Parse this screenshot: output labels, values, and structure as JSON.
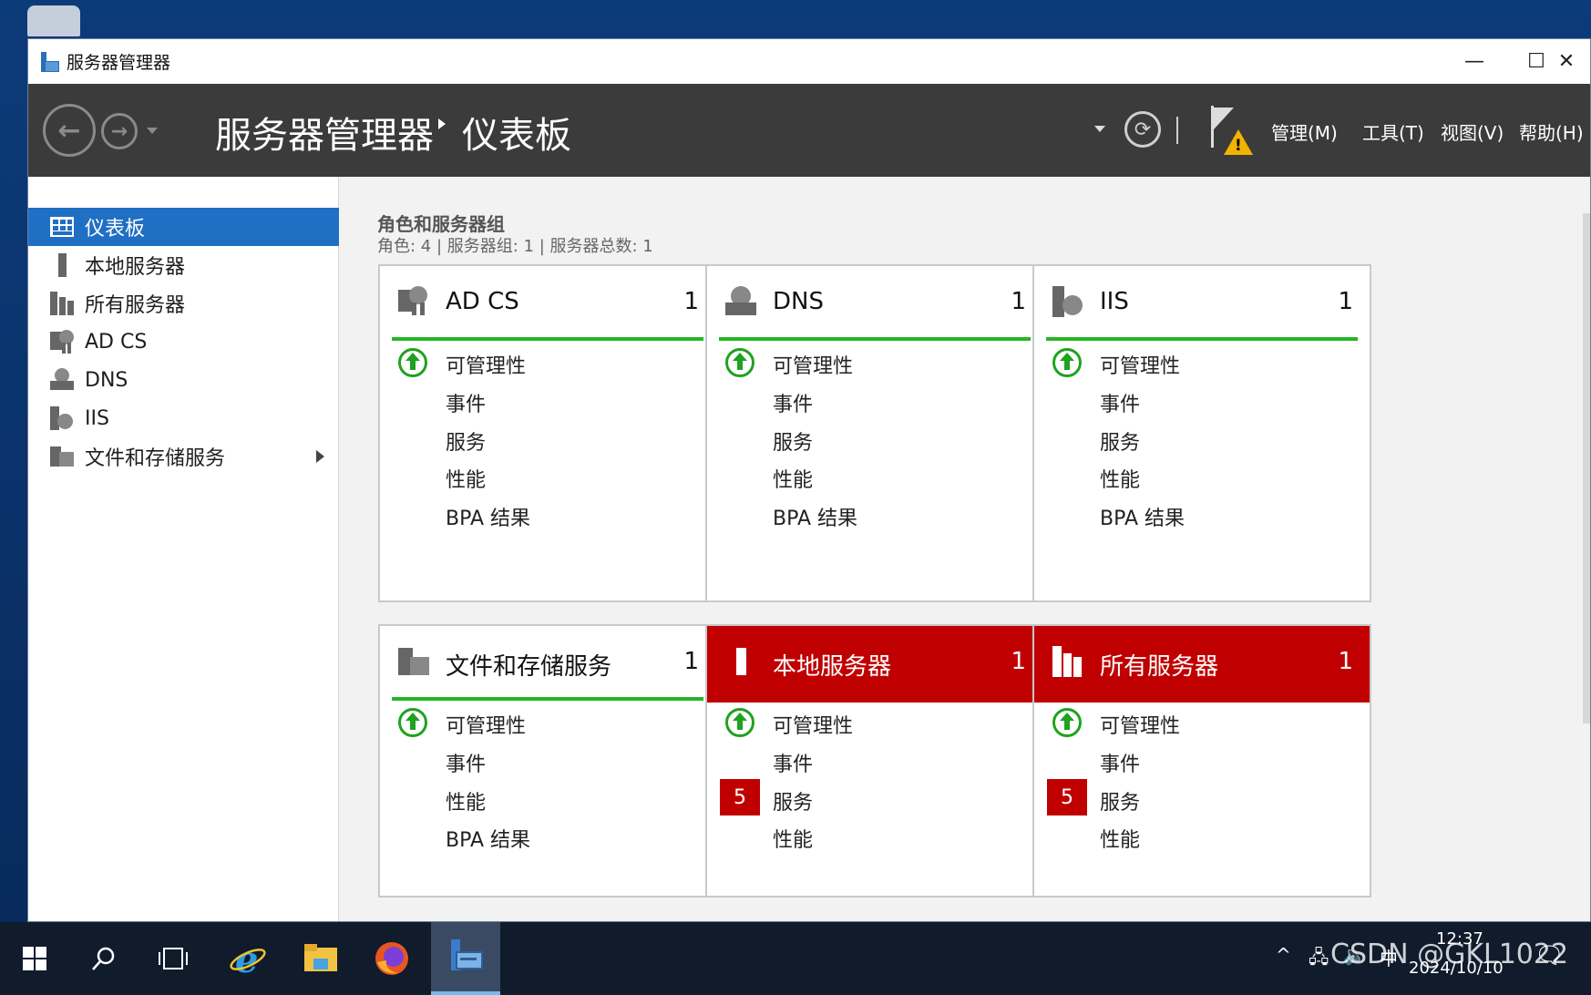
{
  "window": {
    "title": "服务器管理器",
    "controls": {
      "minimize": "—",
      "maximize": "☐",
      "close": "✕"
    }
  },
  "header": {
    "breadcrumb_root": "服务器管理器",
    "breadcrumb_page": "仪表板",
    "menus": [
      "管理(M)",
      "工具(T)",
      "视图(V)",
      "帮助(H)"
    ],
    "refresh_glyph": "⟳"
  },
  "sidebar": {
    "items": [
      {
        "label": "仪表板",
        "icon": "dashboard-icon",
        "active": true
      },
      {
        "label": "本地服务器",
        "icon": "local-server-icon"
      },
      {
        "label": "所有服务器",
        "icon": "all-servers-icon"
      },
      {
        "label": "AD CS",
        "icon": "adcs-icon"
      },
      {
        "label": "DNS",
        "icon": "dns-icon"
      },
      {
        "label": "IIS",
        "icon": "iis-icon"
      },
      {
        "label": "文件和存储服务",
        "icon": "file-storage-icon",
        "expandable": true
      }
    ]
  },
  "main": {
    "section_title": "角色和服务器组",
    "section_subtitle": "角色: 4 | 服务器组: 1 | 服务器总数: 1",
    "tiles": [
      {
        "name": "AD CS",
        "count": "1",
        "status": "ok",
        "icon": "adcs-icon",
        "rows": [
          {
            "label": "可管理性",
            "status": "ok"
          },
          {
            "label": "事件"
          },
          {
            "label": "服务"
          },
          {
            "label": "性能"
          },
          {
            "label": "BPA 结果"
          }
        ]
      },
      {
        "name": "DNS",
        "count": "1",
        "status": "ok",
        "icon": "dns-icon",
        "rows": [
          {
            "label": "可管理性",
            "status": "ok"
          },
          {
            "label": "事件"
          },
          {
            "label": "服务"
          },
          {
            "label": "性能"
          },
          {
            "label": "BPA 结果"
          }
        ]
      },
      {
        "name": "IIS",
        "count": "1",
        "status": "ok",
        "icon": "iis-icon",
        "rows": [
          {
            "label": "可管理性",
            "status": "ok"
          },
          {
            "label": "事件"
          },
          {
            "label": "服务"
          },
          {
            "label": "性能"
          },
          {
            "label": "BPA 结果"
          }
        ]
      },
      {
        "name": "文件和存储服务",
        "count": "1",
        "status": "ok",
        "icon": "file-storage-icon",
        "rows": [
          {
            "label": "可管理性",
            "status": "ok"
          },
          {
            "label": "事件"
          },
          {
            "label": "性能"
          },
          {
            "label": "BPA 结果"
          }
        ]
      },
      {
        "name": "本地服务器",
        "count": "1",
        "status": "error",
        "icon": "local-server-icon",
        "rows": [
          {
            "label": "可管理性",
            "status": "ok"
          },
          {
            "label": "事件"
          },
          {
            "label": "服务",
            "badge": "5"
          },
          {
            "label": "性能"
          }
        ]
      },
      {
        "name": "所有服务器",
        "count": "1",
        "status": "error",
        "icon": "all-servers-icon",
        "rows": [
          {
            "label": "可管理性",
            "status": "ok"
          },
          {
            "label": "事件"
          },
          {
            "label": "服务",
            "badge": "5"
          },
          {
            "label": "性能"
          }
        ]
      }
    ]
  },
  "taskbar": {
    "items": [
      "windows-start-icon",
      "search-icon",
      "task-view-icon",
      "internet-explorer-icon",
      "file-explorer-icon",
      "firefox-icon",
      "server-manager-icon"
    ],
    "clock_time": "12:37",
    "clock_date": "2024/10/10"
  },
  "watermark": "CSDN @GKL1022",
  "colors": {
    "accent": "#1f6fc4",
    "header_bg": "#3b3b3b",
    "ok_green": "#26b426",
    "error_red": "#c00000"
  }
}
